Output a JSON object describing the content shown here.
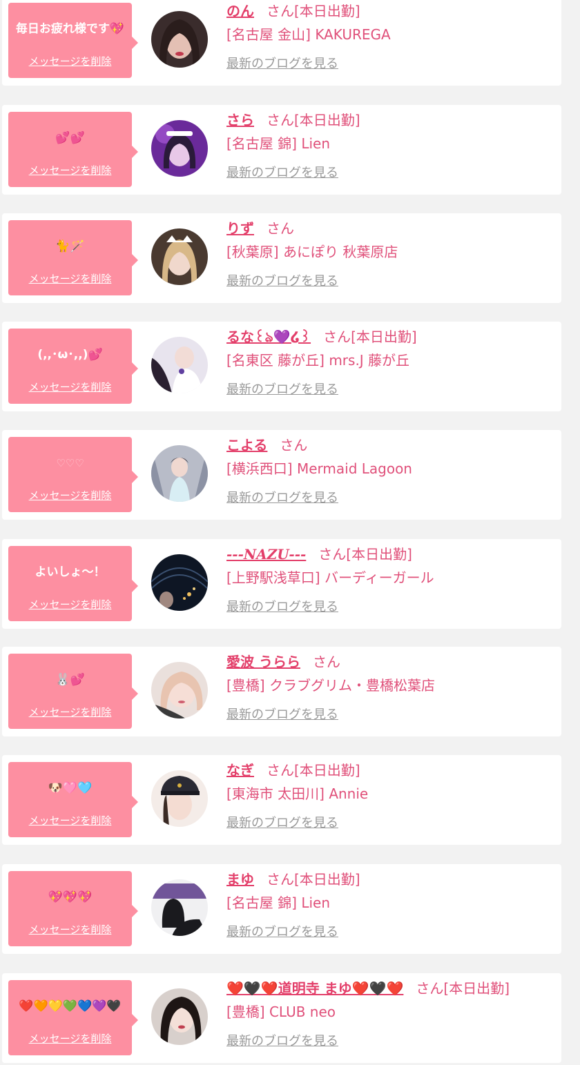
{
  "common": {
    "delete_label": "メッセージを削除",
    "san_label": "さん",
    "blog_label": "最新のブログを見る"
  },
  "colors": {
    "bubble": "#fd8fa1",
    "name": "#e33f6a",
    "text": "#e0507a",
    "link_gray": "#999999",
    "card": "#ffffff",
    "background": "#f2f2f2"
  },
  "items": [
    {
      "message": "毎日お疲れ様です💖",
      "name": "のん",
      "work": "[本日出勤]",
      "shop": "[名古屋 金山] KAKUREGA",
      "avatar_icon": "profile-photo"
    },
    {
      "message": "💕💕",
      "name": "さら",
      "work": "[本日出勤]",
      "shop": "[名古屋 錦] Lien",
      "avatar_icon": "profile-photo"
    },
    {
      "message": "🐈🪄",
      "name": "りず",
      "work": "",
      "shop": "[秋葉原] あにぽり 秋葉原店",
      "avatar_icon": "profile-photo"
    },
    {
      "message": "(,,･ω･,,)💕",
      "name": "るな꒰ঌ💜໒꒱",
      "work": "[本日出勤]",
      "shop": "[名東区 藤が丘] mrs.J 藤が丘",
      "avatar_icon": "profile-photo"
    },
    {
      "message": "♡♡♡",
      "name": "こよる",
      "work": "",
      "shop": "[横浜西口] Mermaid Lagoon",
      "avatar_icon": "profile-photo"
    },
    {
      "message": "よいしょ〜！",
      "name": "---NAZU---",
      "work": "[本日出勤]",
      "shop": "[上野駅浅草口] バーディーガール",
      "avatar_icon": "profile-photo"
    },
    {
      "message": "🐰💕",
      "name": "愛波 うらら",
      "work": "",
      "shop": "[豊橋] クラブグリム・豊橋松葉店",
      "avatar_icon": "profile-photo"
    },
    {
      "message": "🐶🩷🩵",
      "name": "なぎ",
      "work": "[本日出勤]",
      "shop": "[東海市 太田川] Annie",
      "avatar_icon": "profile-photo"
    },
    {
      "message": "💖💖💖",
      "name": "まゆ",
      "work": "[本日出勤]",
      "shop": "[名古屋 錦] Lien",
      "avatar_icon": "profile-photo"
    },
    {
      "message": "❤️🧡💛💚💙💜🖤",
      "name": "❤️🖤❤️道明寺 まゆ❤️🖤❤️",
      "work": "[本日出勤]",
      "shop": "[豊橋] CLUB neo",
      "avatar_icon": "profile-photo"
    }
  ]
}
